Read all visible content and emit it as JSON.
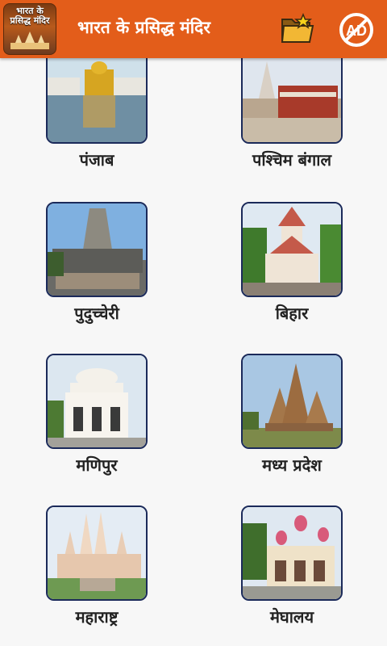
{
  "header": {
    "title": "भारत के प्रसिद्ध मंदिर",
    "logo_text": "भारत के प्रसिद्ध मंदिर",
    "background_color": "#e35d1a"
  },
  "toolbar": {
    "folder_icon": "folder-star-icon",
    "noads_icon": "no-ads-icon",
    "noads_text": "AD"
  },
  "states": [
    {
      "label": "पंजाब"
    },
    {
      "label": "पश्चिम बंगाल"
    },
    {
      "label": "पुदुच्चेरी"
    },
    {
      "label": "बिहार"
    },
    {
      "label": "मणिपुर"
    },
    {
      "label": "मध्य प्रदेश"
    },
    {
      "label": "महाराष्ट्र"
    },
    {
      "label": "मेघालय"
    }
  ]
}
